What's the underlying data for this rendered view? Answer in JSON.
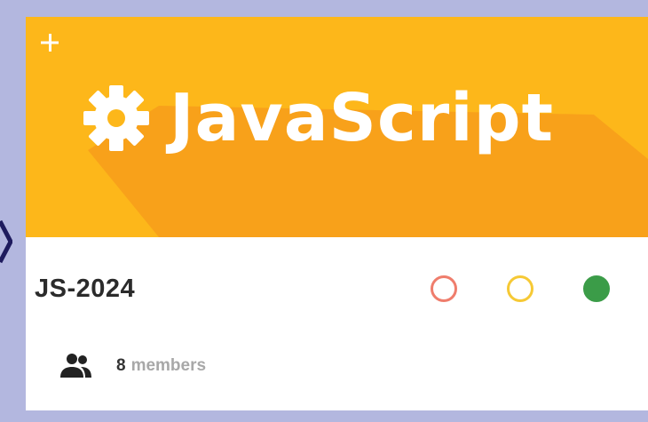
{
  "banner": {
    "title": "JavaScript",
    "background_color": "#fdb71a",
    "shadow_color": "#f79e1b",
    "icons": {
      "add": "plus-icon",
      "logo": "gear-icon"
    }
  },
  "course": {
    "code": "JS-2024",
    "status_dots": [
      {
        "name": "red",
        "color": "#ef7d6c",
        "filled": false
      },
      {
        "name": "yellow",
        "color": "#f6c935",
        "filled": false
      },
      {
        "name": "green",
        "color": "#3b9c48",
        "filled": true
      }
    ]
  },
  "members": {
    "count": "8",
    "label": "members",
    "icon": "people-icon"
  },
  "page": {
    "background_color": "#b3b7df",
    "pointer_color": "#1e1b5e"
  }
}
